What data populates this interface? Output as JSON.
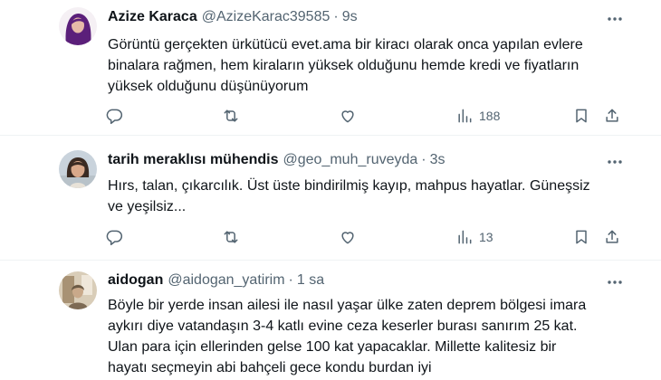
{
  "tweets": [
    {
      "name": "Azize Karaca",
      "handle": "@AzizeKarac39585",
      "separator": "·",
      "time": "9s",
      "lines": [
        "Görüntü gerçekten ürkütücü evet.ama bir kiracı olarak onca yapılan evlere",
        "binalara rağmen, hem kiraların yüksek olduğunu hemde kredi ve fiyatların",
        "yüksek olduğunu düşünüyorum"
      ],
      "views": "188",
      "avatar_colors": {
        "bg": "#f5f0f4",
        "hair": "#5b1f7a",
        "face": "#e6b9a8"
      },
      "icons": [
        "more-icon",
        "reply-icon",
        "retweet-icon",
        "like-icon",
        "views-icon",
        "bookmark-icon",
        "share-icon"
      ]
    },
    {
      "name": "tarih meraklısı mühendis",
      "handle": "@geo_muh_ruveyda",
      "separator": "·",
      "time": "3s",
      "lines": [
        "Hırs, talan, çıkarcılık. Üst üste bindirilmiş kayıp, mahpus hayatlar. Güneşsiz",
        "ve yeşilsiz..."
      ],
      "views": "13",
      "avatar_colors": {
        "bg": "#c9d3dc",
        "hair": "#3a2a22",
        "face": "#d9a88a"
      },
      "icons": [
        "more-icon",
        "reply-icon",
        "retweet-icon",
        "like-icon",
        "views-icon",
        "bookmark-icon",
        "share-icon"
      ]
    },
    {
      "name": "aidogan",
      "handle": "@aidogan_yatirim",
      "separator": "·",
      "time": "1 sa",
      "lines": [
        "Böyle bir yerde insan ailesi ile nasıl yaşar ülke zaten deprem bölgesi imara",
        "aykırı diye vatandaşın 3-4 katlı evine ceza keserler burası sanırım 25 kat.",
        "Ulan para için ellerinden gelse 100 kat yapacaklar. Millette kalitesiz bir",
        "hayatı seçmeyin abi bahçeli gece kondu burdan iyi"
      ],
      "avatar_colors": {
        "bg": "#d9cdb8",
        "hair": "#6b5a45",
        "face": "#c9a98a"
      },
      "icons": [
        "more-icon"
      ]
    }
  ],
  "colors": {
    "text": "#0f1419",
    "secondary": "#536471",
    "divider": "#eff3f4"
  }
}
